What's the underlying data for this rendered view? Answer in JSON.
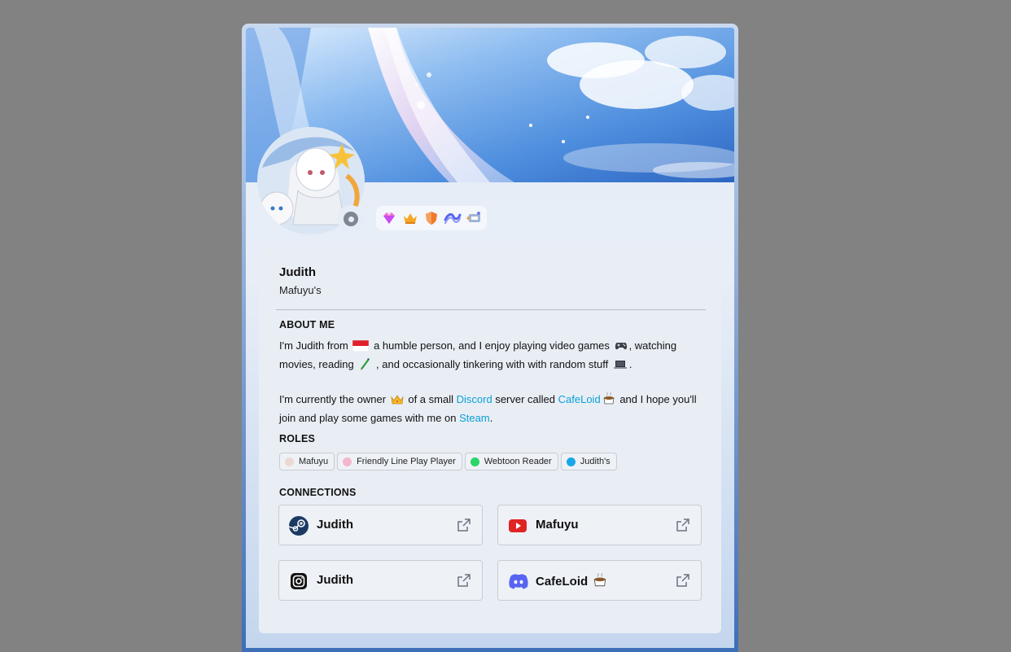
{
  "profile": {
    "display_name": "Judith",
    "username": "Mafuyu's",
    "status": "offline"
  },
  "badges": [
    {
      "name": "nitro-gem-badge"
    },
    {
      "name": "crown-badge"
    },
    {
      "name": "shield-badge"
    },
    {
      "name": "hypesquad-balance-badge"
    },
    {
      "name": "quest-badge"
    }
  ],
  "about": {
    "title": "ABOUT ME",
    "line1_a": "I'm Judith from",
    "line1_b": "a humble person, and I enjoy playing video games",
    "line1_c": ", watching movies, reading",
    "line1_d": ", and occasionally tinkering with with random stuff",
    "line1_e": ".",
    "line2_a": "I'm currently the owner",
    "line2_b": "of a small",
    "discord_link": "Discord",
    "line2_c": "server called",
    "cafeloid_link": "CafeLoid",
    "line2_d": "and I hope you'll join and play some games with me on",
    "steam_link": "Steam",
    "line2_e": "."
  },
  "roles": {
    "title": "ROLES",
    "items": [
      {
        "label": "Mafuyu",
        "color": "#eed8d2"
      },
      {
        "label": "Friendly Line Play Player",
        "color": "#f4b6cc"
      },
      {
        "label": "Webtoon Reader",
        "color": "#2bd566"
      },
      {
        "label": "Judith's",
        "color": "#1aa7ea"
      }
    ]
  },
  "connections": {
    "title": "CONNECTIONS",
    "items": [
      {
        "service": "steam",
        "label": "Judith"
      },
      {
        "service": "youtube",
        "label": "Mafuyu"
      },
      {
        "service": "instagram",
        "label": "Judith"
      },
      {
        "service": "discord",
        "label": "CafeLoid"
      }
    ]
  },
  "colors": {
    "accent_link": "#0a9fd8",
    "card_border_top": "#c9d9ef",
    "card_border_bottom": "#3d6fb8",
    "background": "#828282"
  }
}
